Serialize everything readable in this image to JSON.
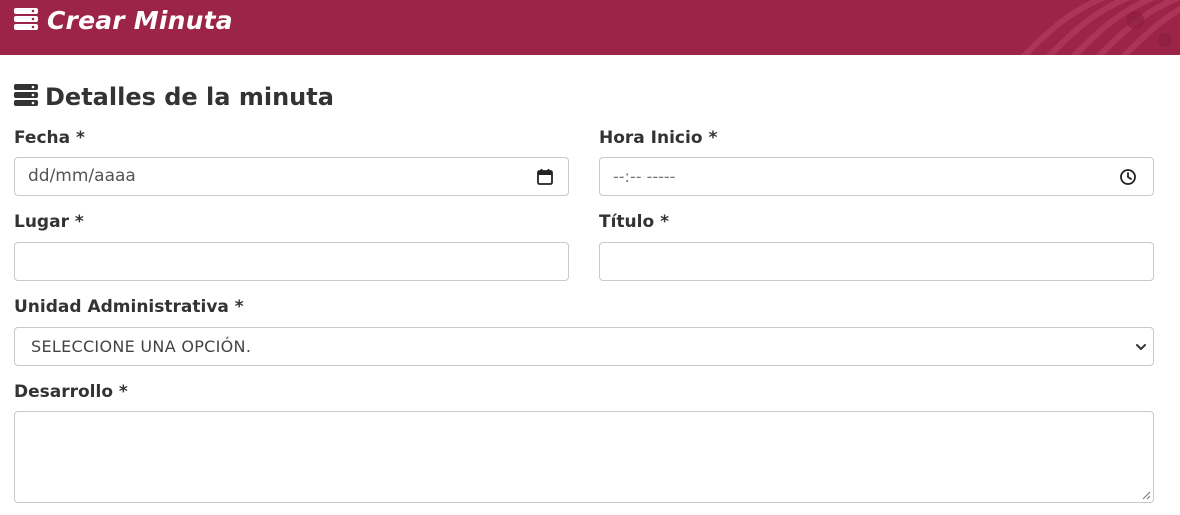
{
  "header": {
    "title": "Crear Minuta",
    "icon": "database-icon",
    "background": "#9d2449"
  },
  "section": {
    "title": "Detalles de la minuta",
    "icon": "database-icon"
  },
  "form": {
    "fecha": {
      "label": "Fecha *",
      "placeholder": "dd/mm/aaaa",
      "icon": "calendar-icon"
    },
    "hora_inicio": {
      "label": "Hora Inicio *",
      "placeholder": "--:-- -----",
      "icon": "clock-icon"
    },
    "lugar": {
      "label": "Lugar *",
      "value": ""
    },
    "titulo": {
      "label": "Título *",
      "value": ""
    },
    "unidad_administrativa": {
      "label": "Unidad Administrativa *",
      "selected": "SELECCIONE UNA OPCIÓN.",
      "icon": "chevron-down-icon"
    },
    "desarrollo": {
      "label": "Desarrollo *",
      "value": ""
    }
  }
}
